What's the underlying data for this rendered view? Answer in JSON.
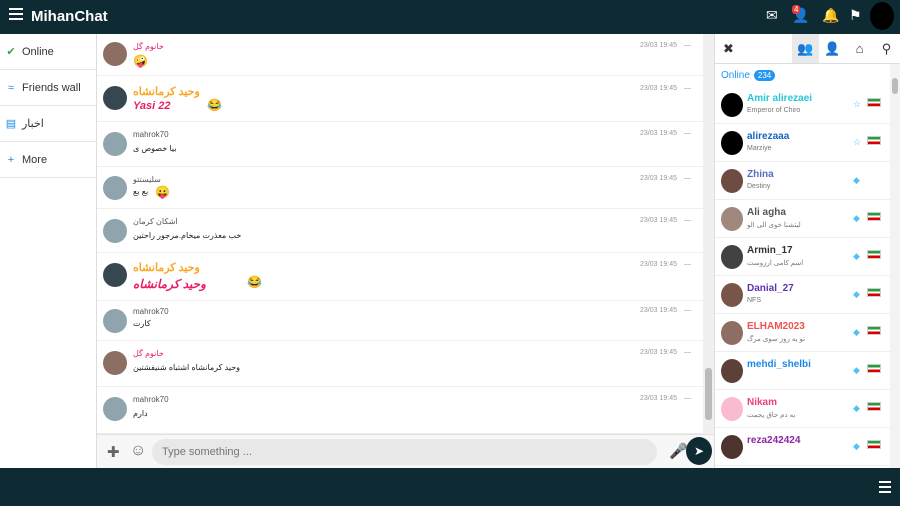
{
  "header": {
    "brand": "MihanChat",
    "notification_count": "4"
  },
  "nav": [
    {
      "label": "Online",
      "icon": "check-circle-icon"
    },
    {
      "label": "Friends wall",
      "icon": "rss-icon"
    },
    {
      "label": "اخبار",
      "icon": "news-icon"
    },
    {
      "label": "More",
      "icon": "plus-icon"
    }
  ],
  "messages": [
    {
      "name": "خانوم گل",
      "text": "",
      "time": "23/03 19:45",
      "name_color": "#e91e63"
    },
    {
      "name": "وحید کرمانشاه",
      "text": "Yasi 22",
      "time": "23/03 19:45",
      "name_color": "#f9a825"
    },
    {
      "name": "mahrok70",
      "text": "بیا خصوص ی",
      "time": "23/03 19:45",
      "name_color": "#555555"
    },
    {
      "name": "سلیستتو",
      "text": "بع بع",
      "time": "23/03 19:45",
      "name_color": "#555555"
    },
    {
      "name": "اشکان کرمان",
      "text": "خب معذرت میخام.مرجور راحتین",
      "time": "23/03 19:45",
      "name_color": "#555555"
    },
    {
      "name": "وحید کرمانشاه",
      "text": "وحید کرمانشاه",
      "time": "23/03 19:45",
      "name_color": "#f9a825"
    },
    {
      "name": "mahrok70",
      "text": "کارت",
      "time": "23/03 19:45",
      "name_color": "#555555"
    },
    {
      "name": "خانوم گل",
      "text": "وحید کرمانشاه اشتباه شنیفشتین",
      "time": "23/03 19:45",
      "name_color": "#e91e63"
    },
    {
      "name": "mahrok70",
      "text": "دارم",
      "time": "23/03 19:45",
      "name_color": "#555555"
    }
  ],
  "composer": {
    "placeholder": "Type something ..."
  },
  "online": {
    "label": "Online",
    "count": "234"
  },
  "users": [
    {
      "name": "Amir alirezaei",
      "mood": "Emperor of Chiro",
      "name_color": "#26c6da"
    },
    {
      "name": "alirezaaa",
      "mood": "Marziye",
      "name_color": "#1565c0"
    },
    {
      "name": "Zhina",
      "mood": "Destiny",
      "name_color": "#5c6bc0"
    },
    {
      "name": "Ali agha",
      "mood": "لیتشنا خوی الی الو",
      "name_color": "#555555"
    },
    {
      "name": "Armin_17",
      "mood": "اسم کامی ارزوست",
      "name_color": "#333333"
    },
    {
      "name": "Danial_27",
      "mood": "NFS",
      "name_color": "#5e35b1"
    },
    {
      "name": "ELHAM2023",
      "mood": "تو یه روز سوی مرگ",
      "name_color": "#ef5350"
    },
    {
      "name": "mehdi_shelbi",
      "mood": "",
      "name_color": "#1e88e5"
    },
    {
      "name": "Nikam",
      "mood": "به دم جاق یجمت",
      "name_color": "#ec407a"
    },
    {
      "name": "reza242424",
      "mood": "",
      "name_color": "#8e24aa"
    }
  ]
}
